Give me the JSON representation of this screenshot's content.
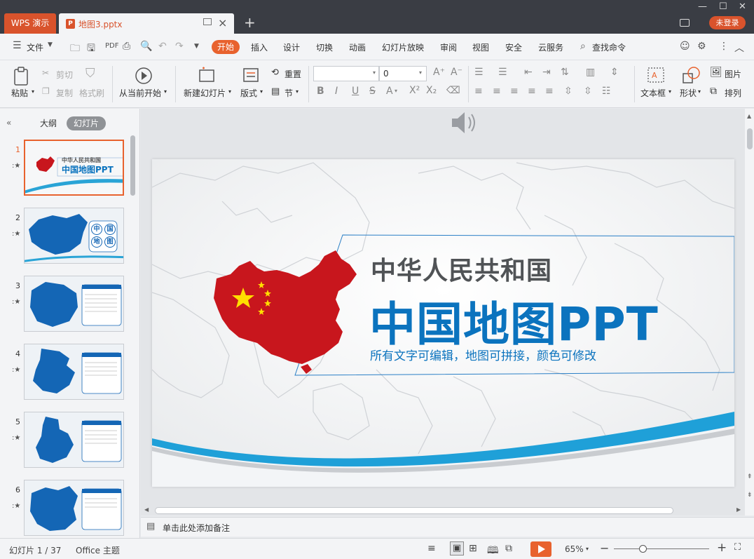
{
  "titlebar": {
    "app_tab": "WPS 演示",
    "doc_tab": "地图3.pptx",
    "login": "未登录"
  },
  "menu": {
    "file": "文件",
    "start": "开始",
    "items": [
      "插入",
      "设计",
      "切换",
      "动画",
      "幻灯片放映",
      "审阅",
      "视图",
      "安全",
      "云服务"
    ],
    "search": "查找命令"
  },
  "ribbon": {
    "paste": "粘贴",
    "cut": "剪切",
    "copy": "复制",
    "format_painter": "格式刷",
    "from_current": "从当前开始",
    "new_slide": "新建幻灯片",
    "layout": "版式",
    "reset": "重置",
    "section": "节",
    "font_size": "0",
    "textbox": "文本框",
    "shape": "形状",
    "picture": "图片",
    "arrange": "排列"
  },
  "left_panel": {
    "outline_tab": "大纲",
    "slides_tab": "幻灯片",
    "slide_numbers": [
      "1",
      "2",
      "3",
      "4",
      "5",
      "6"
    ],
    "thumb1_title1": "中华人民共和国",
    "thumb1_title2": "中国地图PPT",
    "thumb2_labels": [
      "中",
      "国",
      "地",
      "图"
    ]
  },
  "slide": {
    "title1": "中华人民共和国",
    "title2": "中国地图PPT",
    "subtitle": "所有文字可编辑，地图可拼接，颜色可修改"
  },
  "notes": {
    "placeholder": "单击此处添加备注"
  },
  "status": {
    "slide_counter": "幻灯片 1 / 37",
    "theme": "Office 主题",
    "zoom": "65%"
  },
  "colors": {
    "accent": "#e8622e",
    "title_blue": "#0b73be",
    "map_red": "#c8161d",
    "star_yellow": "#ffde00"
  }
}
